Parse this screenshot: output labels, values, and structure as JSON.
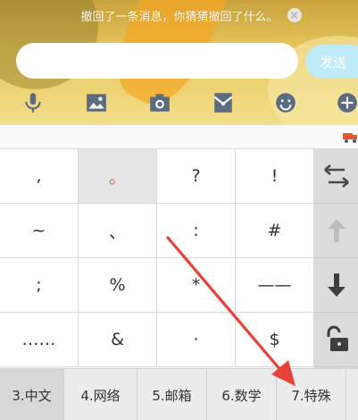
{
  "chat": {
    "notice": "撤回了一条消息，你猜猜撤回了什么。",
    "notice_close": "×",
    "input_value": "",
    "send_label": "发送"
  },
  "toolbar": {
    "items": [
      {
        "name": "microphone-icon",
        "color": "#5b6b80"
      },
      {
        "name": "image-icon",
        "color": "#5b6b80"
      },
      {
        "name": "camera-icon",
        "color": "#5b6b80"
      },
      {
        "name": "red-envelope-icon",
        "color": "#5b6b80"
      },
      {
        "name": "emoji-icon",
        "color": "#5b6b80"
      },
      {
        "name": "plus-icon",
        "color": "#5b6b80"
      }
    ]
  },
  "keyboard": {
    "rows": [
      [
        ",",
        "。",
        "?",
        "!"
      ],
      [
        "~",
        "、",
        ":",
        "#"
      ],
      [
        ";",
        "%",
        "*",
        "——"
      ],
      [
        "……",
        "&",
        "·",
        "$"
      ]
    ],
    "active_key": "。",
    "side_keys": [
      {
        "name": "switch-icon"
      },
      {
        "name": "up-arrow-icon"
      },
      {
        "name": "down-arrow-icon"
      },
      {
        "name": "unlock-icon"
      }
    ],
    "tabs": [
      "3.中文",
      "4.网络",
      "5.邮箱",
      "6.数学",
      "7.特殊"
    ],
    "active_tab": "3.中文"
  },
  "colors": {
    "accent_punct": "#f06b3a",
    "send_button": "#bfeaf7",
    "annotation_arrow": "#e8413a"
  }
}
